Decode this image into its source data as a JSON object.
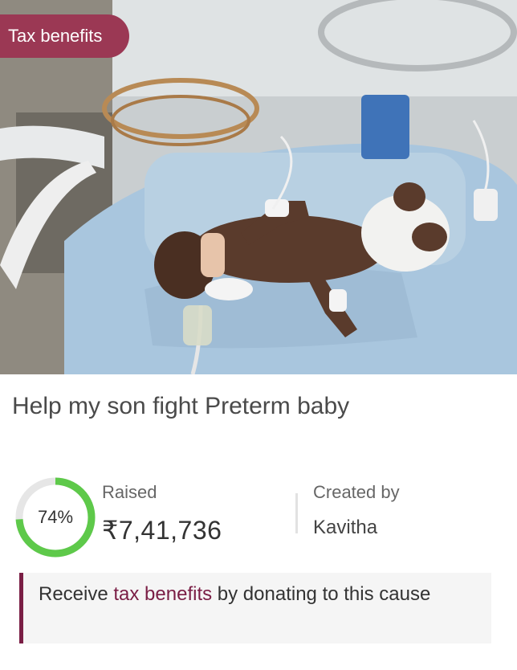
{
  "badge": {
    "label": "Tax benefits"
  },
  "campaign": {
    "title": "Help my son fight Preterm baby",
    "progress_percent": 74,
    "progress_label": "74%",
    "raised_label": "Raised",
    "raised_amount": "₹7,41,736",
    "created_by_label": "Created by",
    "creator_name": "Kavitha"
  },
  "notice": {
    "prefix": "Receive ",
    "link_text": "tax benefits",
    "suffix": " by donating to this cause"
  },
  "colors": {
    "badge_bg": "#9b3854",
    "progress_ring": "#5ec94a",
    "progress_track": "#e6e6e6",
    "notice_accent": "#7a1e45",
    "link": "#7a1e45"
  }
}
